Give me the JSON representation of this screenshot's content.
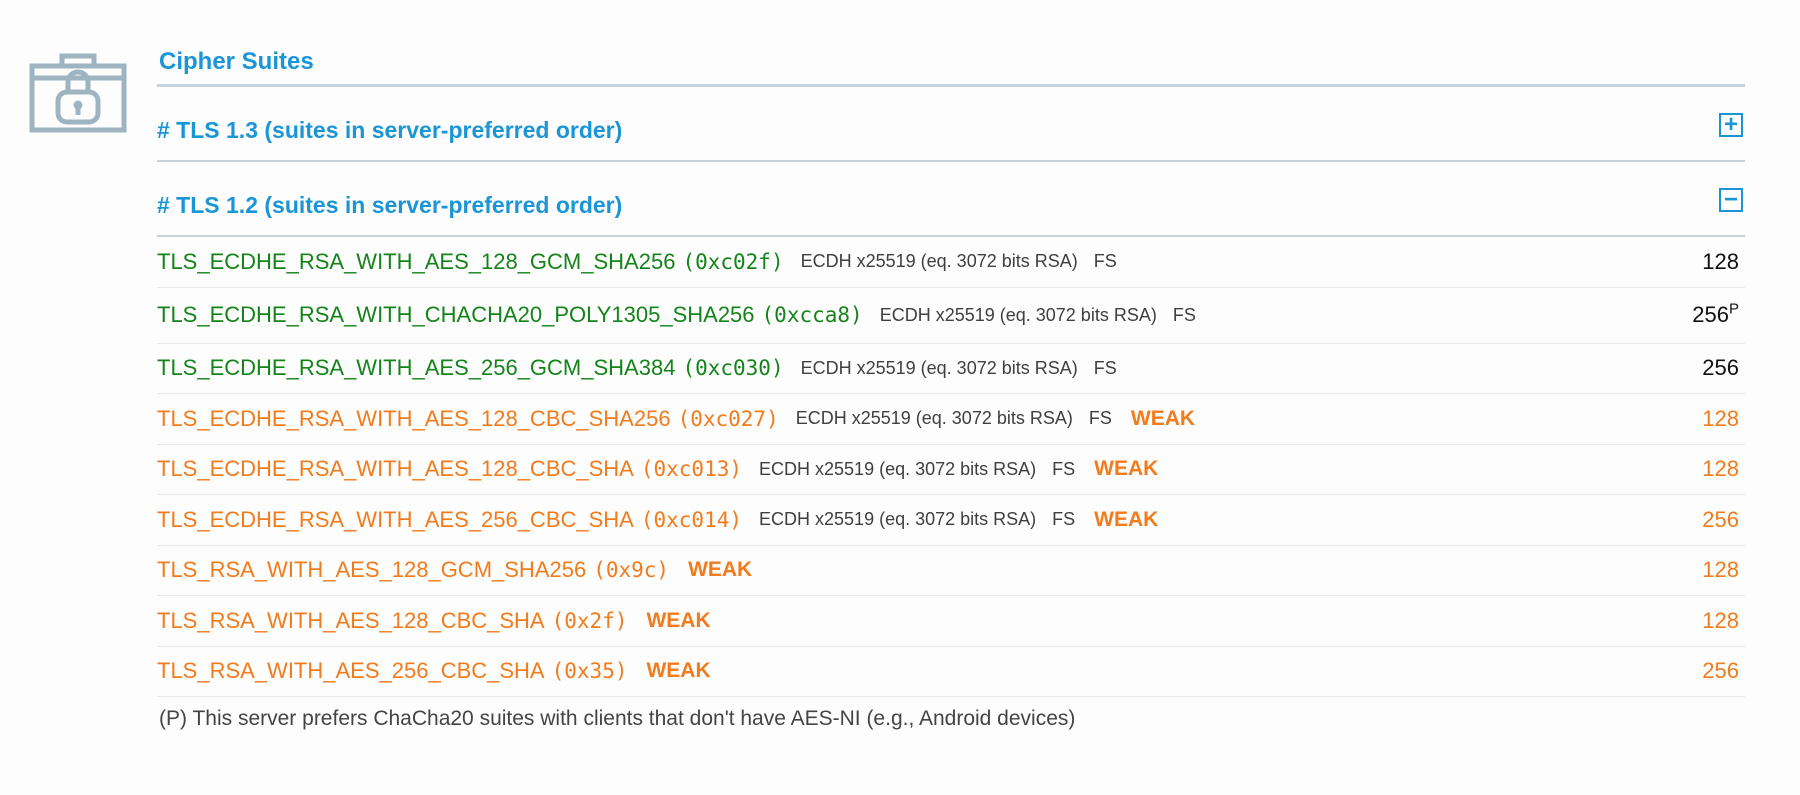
{
  "section": {
    "title": "Cipher Suites"
  },
  "tls13": {
    "title": "# TLS 1.3 (suites in server-preferred order)",
    "toggle": "+"
  },
  "tls12": {
    "title": "# TLS 1.2 (suites in server-preferred order)",
    "toggle": "−",
    "suites": [
      {
        "name": "TLS_ECDHE_RSA_WITH_AES_128_GCM_SHA256",
        "code": "(0xc02f)",
        "kx": "ECDH x25519 (eq. 3072 bits RSA)",
        "fs": "FS",
        "weak": "",
        "bits": "128",
        "sup": ""
      },
      {
        "name": "TLS_ECDHE_RSA_WITH_CHACHA20_POLY1305_SHA256",
        "code": "(0xcca8)",
        "kx": "ECDH x25519 (eq. 3072 bits RSA)",
        "fs": "FS",
        "weak": "",
        "bits": "256",
        "sup": "P"
      },
      {
        "name": "TLS_ECDHE_RSA_WITH_AES_256_GCM_SHA384",
        "code": "(0xc030)",
        "kx": "ECDH x25519 (eq. 3072 bits RSA)",
        "fs": "FS",
        "weak": "",
        "bits": "256",
        "sup": ""
      },
      {
        "name": "TLS_ECDHE_RSA_WITH_AES_128_CBC_SHA256",
        "code": "(0xc027)",
        "kx": "ECDH x25519 (eq. 3072 bits RSA)",
        "fs": "FS",
        "weak": "WEAK",
        "bits": "128",
        "sup": ""
      },
      {
        "name": "TLS_ECDHE_RSA_WITH_AES_128_CBC_SHA",
        "code": "(0xc013)",
        "kx": "ECDH x25519 (eq. 3072 bits RSA)",
        "fs": "FS",
        "weak": "WEAK",
        "bits": "128",
        "sup": ""
      },
      {
        "name": "TLS_ECDHE_RSA_WITH_AES_256_CBC_SHA",
        "code": "(0xc014)",
        "kx": "ECDH x25519 (eq. 3072 bits RSA)",
        "fs": "FS",
        "weak": "WEAK",
        "bits": "256",
        "sup": ""
      },
      {
        "name": "TLS_RSA_WITH_AES_128_GCM_SHA256",
        "code": "(0x9c)",
        "kx": "",
        "fs": "",
        "weak": "WEAK",
        "bits": "128",
        "sup": ""
      },
      {
        "name": "TLS_RSA_WITH_AES_128_CBC_SHA",
        "code": "(0x2f)",
        "kx": "",
        "fs": "",
        "weak": "WEAK",
        "bits": "128",
        "sup": ""
      },
      {
        "name": "TLS_RSA_WITH_AES_256_CBC_SHA",
        "code": "(0x35)",
        "kx": "",
        "fs": "",
        "weak": "WEAK",
        "bits": "256",
        "sup": ""
      }
    ]
  },
  "note": "(P) This server prefers ChaCha20 suites with clients that don't have AES-NI (e.g., Android devices)",
  "icons": {
    "section": "lock-case-icon",
    "expand": "plus-box-icon",
    "collapse": "minus-box-icon"
  },
  "colors": {
    "heading": "#1a96d6",
    "ok": "#14841a",
    "weak": "#f27b1c",
    "icon": "#9fb4c1"
  }
}
